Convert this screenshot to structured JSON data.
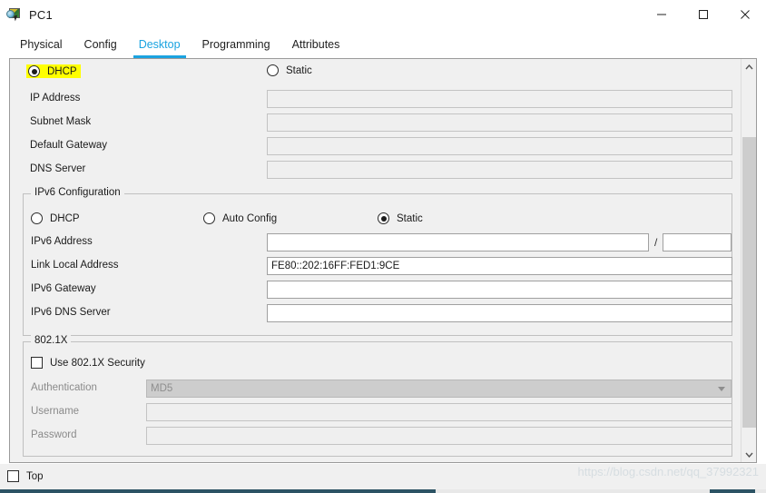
{
  "window": {
    "title": "PC1",
    "icon": "pc-device-icon",
    "controls": {
      "minimize": "minimize-icon",
      "maximize": "maximize-icon",
      "close": "close-icon"
    }
  },
  "tabs": [
    {
      "label": "Physical",
      "active": false
    },
    {
      "label": "Config",
      "active": false
    },
    {
      "label": "Desktop",
      "active": true
    },
    {
      "label": "Programming",
      "active": false
    },
    {
      "label": "Attributes",
      "active": false
    }
  ],
  "colors": {
    "accent": "#1aa3e0",
    "highlight": "#ffff00",
    "panel": "#f0f0f0",
    "bottom_bar": "#2c5364"
  },
  "ip_configuration": {
    "mode_dhcp_label": "DHCP",
    "mode_dhcp_selected": true,
    "mode_dhcp_highlighted": true,
    "mode_static_label": "Static",
    "mode_static_selected": false,
    "fields": [
      {
        "label": "IP Address",
        "value": "",
        "disabled": true
      },
      {
        "label": "Subnet Mask",
        "value": "",
        "disabled": true
      },
      {
        "label": "Default Gateway",
        "value": "",
        "disabled": true
      },
      {
        "label": "DNS Server",
        "value": "",
        "disabled": true
      }
    ]
  },
  "ipv6_configuration": {
    "group_title": "IPv6 Configuration",
    "modes": [
      {
        "label": "DHCP",
        "selected": false
      },
      {
        "label": "Auto Config",
        "selected": false
      },
      {
        "label": "Static",
        "selected": true
      }
    ],
    "address_label": "IPv6 Address",
    "address_value": "",
    "prefix_separator": "/",
    "prefix_value": "",
    "fields": [
      {
        "label": "Link Local Address",
        "value": "FE80::202:16FF:FED1:9CE",
        "disabled": false
      },
      {
        "label": "IPv6 Gateway",
        "value": "",
        "disabled": false
      },
      {
        "label": "IPv6 DNS Server",
        "value": "",
        "disabled": false
      }
    ]
  },
  "dot1x": {
    "group_title": "802.1X",
    "use_security_label": "Use 802.1X Security",
    "use_security_checked": false,
    "authentication_label": "Authentication",
    "authentication_value": "MD5",
    "authentication_disabled": true,
    "username_label": "Username",
    "username_value": "",
    "password_label": "Password",
    "password_value": ""
  },
  "footer": {
    "top_checkbox_label": "Top",
    "top_checkbox_checked": false,
    "watermark": "https://blog.csdn.net/qq_37992321"
  },
  "scrollbar": {
    "up_arrow": "chevron-up-icon",
    "down_arrow": "chevron-down-icon"
  }
}
